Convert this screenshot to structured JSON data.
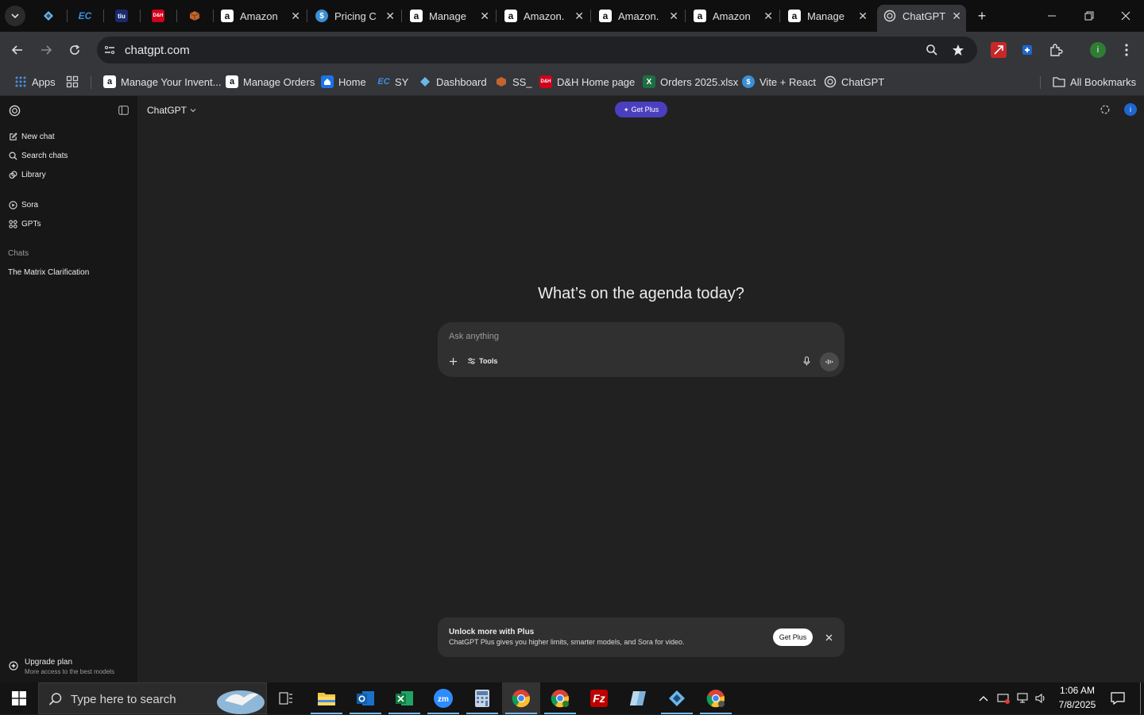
{
  "browser": {
    "tabs": [
      {
        "title": "",
        "favicon": "diamond",
        "color": "#5b9bd5",
        "pinned": true
      },
      {
        "title": "",
        "favicon": "EC",
        "color": "#2a7de1",
        "pinned": true
      },
      {
        "title": "",
        "favicon": "tiu",
        "color": "#1b2a6b",
        "pinned": true
      },
      {
        "title": "",
        "favicon": "D&H",
        "color": "#d0021b",
        "pinned": true
      },
      {
        "title": "",
        "favicon": "box",
        "color": "#b4532a",
        "pinned": true
      },
      {
        "title": "Amazon",
        "favicon": "a",
        "color": "#232f3e"
      },
      {
        "title": "Pricing C",
        "favicon": "$",
        "color": "#3b8fd4"
      },
      {
        "title": "Manage",
        "favicon": "a",
        "color": "#232f3e"
      },
      {
        "title": "Amazon.",
        "favicon": "a",
        "color": "#ffffff"
      },
      {
        "title": "Amazon.",
        "favicon": "a",
        "color": "#ffffff"
      },
      {
        "title": "Amazon",
        "favicon": "a",
        "color": "#232f3e"
      },
      {
        "title": "Manage",
        "favicon": "a",
        "color": "#232f3e"
      },
      {
        "title": "ChatGPT",
        "favicon": "openai",
        "color": "#9e9e9e",
        "active": true
      }
    ],
    "url": "chatgpt.com",
    "bookmarks": [
      {
        "label": "Apps",
        "icon": "grid"
      },
      {
        "label": "",
        "icon": "tabs-grid"
      },
      {
        "label": "Manage Your Invent...",
        "icon": "a",
        "color": "#232f3e"
      },
      {
        "label": "Manage Orders",
        "icon": "a",
        "color": "#232f3e"
      },
      {
        "label": "Home",
        "icon": "home-blue",
        "color": "#1a73e8"
      },
      {
        "label": "SY",
        "icon": "EC",
        "color": "#2a7de1"
      },
      {
        "label": "Dashboard",
        "icon": "diamond",
        "color": "#5b9bd5"
      },
      {
        "label": "SS_",
        "icon": "box",
        "color": "#b4532a"
      },
      {
        "label": "D&H Home page",
        "icon": "D&H",
        "color": "#d0021b"
      },
      {
        "label": "Orders 2025.xlsx",
        "icon": "X",
        "color": "#1d6f42"
      },
      {
        "label": "Vite + React",
        "icon": "$",
        "color": "#3b8fd4"
      },
      {
        "label": "ChatGPT",
        "icon": "openai",
        "color": "#9e9e9e"
      }
    ],
    "all_bookmarks": "All Bookmarks",
    "profile_initial": "i"
  },
  "sidebar": {
    "items": [
      {
        "label": "New chat",
        "icon": "edit-icon"
      },
      {
        "label": "Search chats",
        "icon": "search-icon"
      },
      {
        "label": "Library",
        "icon": "library-icon"
      },
      {
        "label": "Sora",
        "icon": "sora-icon"
      },
      {
        "label": "GPTs",
        "icon": "gpts-icon"
      }
    ],
    "section_title": "Chats",
    "chats": [
      "The Matrix Clarification"
    ],
    "upgrade_title": "Upgrade plan",
    "upgrade_sub": "More access to the best models"
  },
  "header": {
    "model": "ChatGPT",
    "get_plus": "Get Plus"
  },
  "main": {
    "heading": "What’s on the agenda today?",
    "composer_placeholder": "Ask anything",
    "tools_label": "Tools"
  },
  "banner": {
    "title": "Unlock more with Plus",
    "text": "ChatGPT Plus gives you higher limits, smarter models, and Sora for video.",
    "button": "Get Plus"
  },
  "taskbar": {
    "search_placeholder": "Type here to search",
    "time": "1:06 AM",
    "date": "7/8/2025"
  },
  "colors": {
    "accent_purple": "#4b3fbf",
    "sidebar_bg": "#171717",
    "main_bg": "#212121",
    "composer_bg": "#303030"
  }
}
